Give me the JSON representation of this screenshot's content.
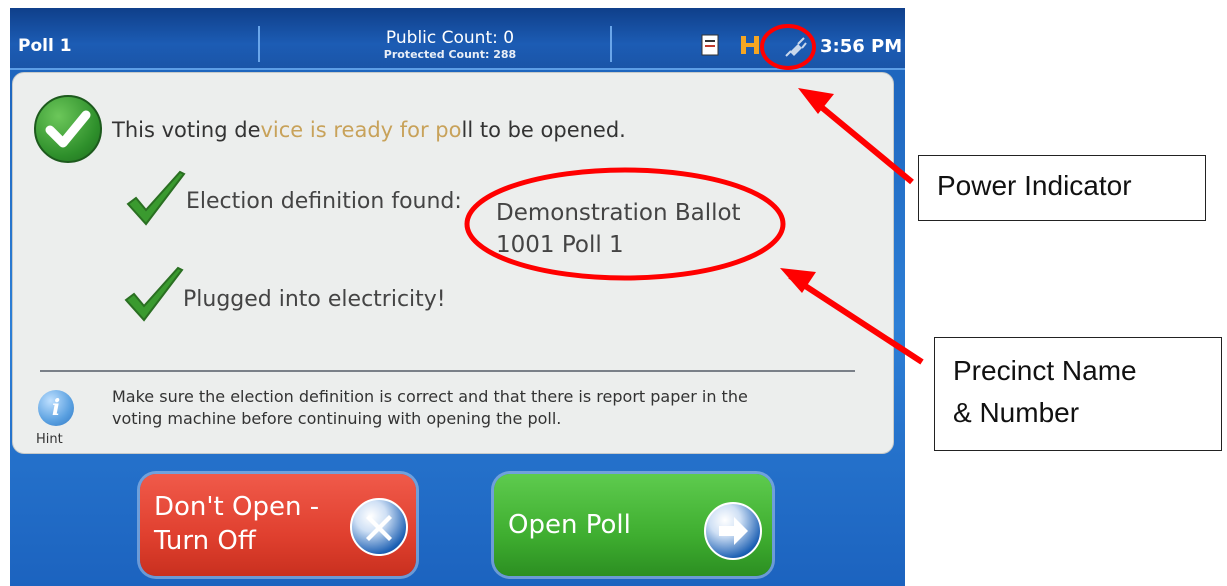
{
  "header": {
    "poll_name": "Poll 1",
    "public_count": "Public Count: 0",
    "protected_count": "Protected Count: 288",
    "time": "3:56 PM",
    "icons": [
      "report-icon",
      "media-icon",
      "power-plug-icon"
    ]
  },
  "status": {
    "ready_text_start": "This voting de",
    "ready_text_faded": "vice is ready for po",
    "ready_text_end": "ll to be opened.",
    "election_definition": "Election definition found:",
    "ballot_name": "Demonstration Ballot",
    "precinct": "1001 Poll 1",
    "plugged": "Plugged into electricity!"
  },
  "hint": {
    "label": "Hint",
    "line1": "Make sure the election definition is correct and that there is report paper in the",
    "line2": "voting machine before continuing with opening the poll."
  },
  "buttons": {
    "dont_open_line1": "Don't Open -",
    "dont_open_line2": "Turn Off",
    "open_poll": "Open Poll"
  },
  "callouts": {
    "power": "Power Indicator",
    "precinct_line1": "Precinct Name",
    "precinct_line2": "& Number"
  },
  "colors": {
    "annotation": "#ff0000",
    "check_green": "#2e8f2b",
    "button_red": "#e0402f",
    "button_green": "#3fae30"
  }
}
